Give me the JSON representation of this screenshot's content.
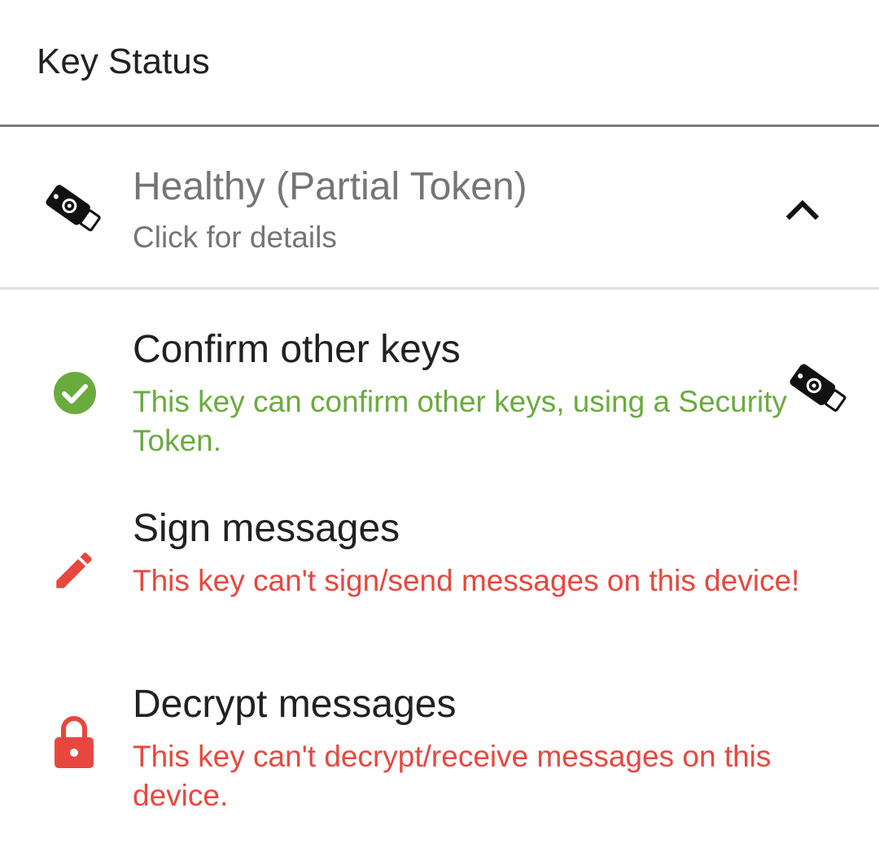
{
  "header": {
    "title": "Key Status"
  },
  "status": {
    "title": "Healthy (Partial Token)",
    "subtitle": "Click for details",
    "icon": "security-token-icon",
    "expand_icon": "chevron-up-icon"
  },
  "items": [
    {
      "title": "Confirm other keys",
      "description": "This key can confirm other keys, using a Security Token.",
      "icon": "check-circle-icon",
      "trailing_icon": "security-token-icon",
      "color": "#6aab3e"
    },
    {
      "title": "Sign messages",
      "description": "This key can't sign/send messages on this device!",
      "icon": "pencil-icon",
      "color": "#e8473f"
    },
    {
      "title": "Decrypt messages",
      "description": "This key can't decrypt/receive messages on this device.",
      "icon": "lock-icon",
      "color": "#e8473f"
    }
  ]
}
